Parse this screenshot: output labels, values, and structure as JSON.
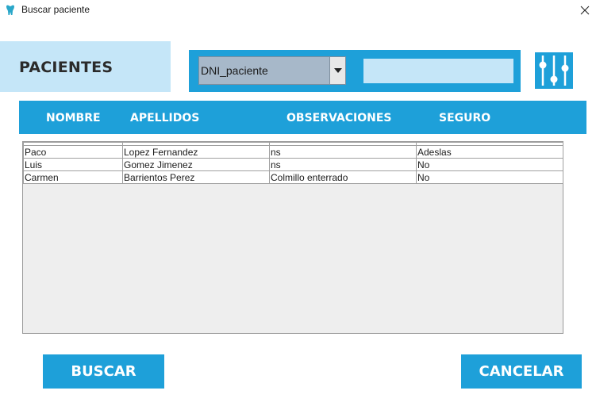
{
  "window": {
    "title": "Buscar paciente"
  },
  "header_panel": {
    "label": "PACIENTES"
  },
  "search": {
    "field_selected": "DNI_paciente",
    "input_value": ""
  },
  "columns": [
    "NOMBRE",
    "APELLIDOS",
    "OBSERVACIONES",
    "SEGURO"
  ],
  "rows": [
    [
      "Paco",
      "Lopez Fernandez",
      "ns",
      "Adeslas"
    ],
    [
      "Luis",
      "Gomez Jimenez",
      "ns",
      "No"
    ],
    [
      "Carmen",
      "Barrientos Perez",
      "Colmillo enterrado",
      "No"
    ]
  ],
  "buttons": {
    "search": "BUSCAR",
    "cancel": "CANCELAR"
  },
  "icons": {
    "app": "tooth-icon",
    "close": "close-icon",
    "filter": "sliders-icon",
    "dropdown": "chevron-down-icon"
  },
  "colors": {
    "accent": "#1ea0d9",
    "light_accent": "#c5e6f8",
    "combo_bg": "#a7b8c9",
    "table_bg": "#eeeeee"
  }
}
